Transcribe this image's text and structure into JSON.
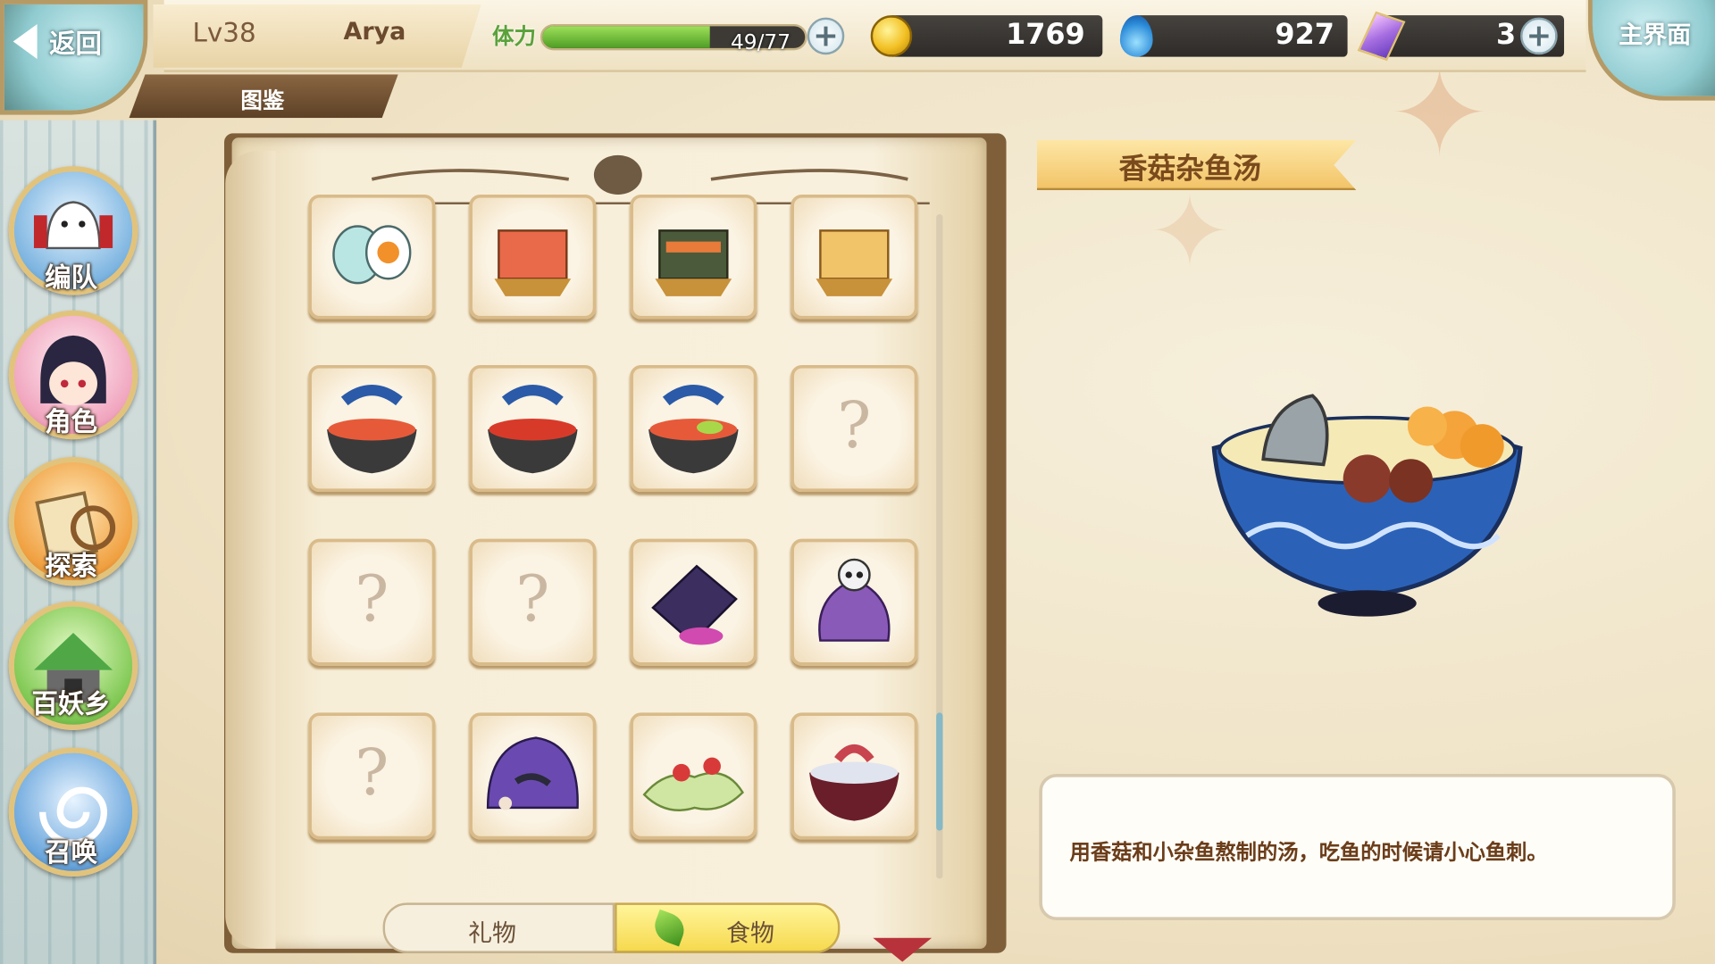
{
  "header": {
    "back_label": "返回",
    "level": "Lv38",
    "player_name": "Arya",
    "section_tab": "图鉴",
    "stamina_label": "体力",
    "stamina_text": "49/77",
    "stamina_value": 49,
    "stamina_max": 77,
    "gold": "1769",
    "soul": "927",
    "gems": "3",
    "home_label": "主界面"
  },
  "sidebar": {
    "items": [
      {
        "label": "编队",
        "icon": "team-icon"
      },
      {
        "label": "角色",
        "icon": "character-icon"
      },
      {
        "label": "探索",
        "icon": "explore-icon"
      },
      {
        "label": "百妖乡",
        "icon": "village-icon"
      },
      {
        "label": "召唤",
        "icon": "summon-icon"
      }
    ]
  },
  "catalog": {
    "tabs": [
      {
        "label": "礼物",
        "active": false
      },
      {
        "label": "食物",
        "active": true
      }
    ],
    "items": [
      {
        "icon": "salted-egg-icon",
        "unlocked": true
      },
      {
        "icon": "tofu-basket-red-icon",
        "unlocked": true
      },
      {
        "icon": "tofu-basket-seaweed-icon",
        "unlocked": true
      },
      {
        "icon": "tofu-basket-plain-icon",
        "unlocked": true
      },
      {
        "icon": "soup-bowl-fish-icon",
        "unlocked": true
      },
      {
        "icon": "soup-bowl-red-icon",
        "unlocked": true
      },
      {
        "icon": "soup-bowl-green-icon",
        "unlocked": true
      },
      {
        "icon": "unknown",
        "unlocked": false,
        "symbol": "?"
      },
      {
        "icon": "unknown",
        "unlocked": false,
        "symbol": "?"
      },
      {
        "icon": "unknown",
        "unlocked": false,
        "symbol": "?"
      },
      {
        "icon": "purple-seaweed-icon",
        "unlocked": true
      },
      {
        "icon": "skull-cloth-bundle-icon",
        "unlocked": true
      },
      {
        "icon": "unknown",
        "unlocked": false,
        "symbol": "?"
      },
      {
        "icon": "purple-slime-mushroom-icon",
        "unlocked": true
      },
      {
        "icon": "green-mushroom-dish-icon",
        "unlocked": true
      },
      {
        "icon": "octopus-rice-bowl-icon",
        "unlocked": true
      }
    ]
  },
  "detail": {
    "title": "香菇杂鱼汤",
    "description": "用香菇和小杂鱼熬制的汤，吃鱼的时候请小心鱼刺。",
    "image_icon": "mushroom-fish-soup-icon"
  },
  "colors": {
    "stamina_fill": "#6fc13a",
    "active_tab": "#f6d94e",
    "accent_brown": "#7a4a1c"
  }
}
